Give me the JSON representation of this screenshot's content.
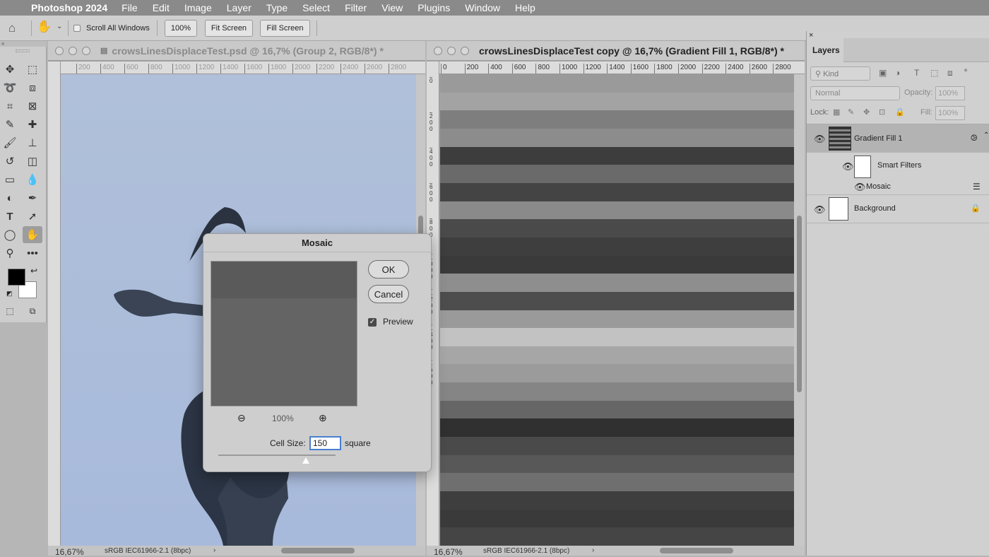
{
  "menubar": {
    "app_name": "Photoshop 2024",
    "items": [
      "File",
      "Edit",
      "Image",
      "Layer",
      "Type",
      "Select",
      "Filter",
      "View",
      "Plugins",
      "Window",
      "Help"
    ]
  },
  "options": {
    "scroll_all_label": "Scroll All Windows",
    "zoom_100": "100%",
    "fit_screen": "Fit Screen",
    "fill_screen": "Fill Screen"
  },
  "doc1": {
    "title": "crowsLinesDisplaceTest.psd @ 16,7% (Group 2, RGB/8*) *",
    "zoom": "16,67%",
    "profile": "sRGB IEC61966-2.1 (8bpc)",
    "hruler": [
      "200",
      "400",
      "600",
      "800",
      "1000",
      "1200",
      "1400",
      "1600",
      "1800",
      "2000",
      "2200",
      "2400",
      "2600",
      "2800"
    ]
  },
  "doc2": {
    "title": "crowsLinesDisplaceTest copy @ 16,7% (Gradient Fill 1, RGB/8*) *",
    "zoom": "16,67%",
    "profile": "sRGB IEC61966-2.1 (8bpc)",
    "hruler": [
      "0",
      "200",
      "400",
      "600",
      "800",
      "1000",
      "1200",
      "1400",
      "1600",
      "1800",
      "2000",
      "2200",
      "2400",
      "2600",
      "2800"
    ],
    "vruler": [
      "0",
      "2\n0\n0",
      "4\n0\n0",
      "6\n0\n0",
      "8\n0\n0",
      "1\n0\n0\n0",
      "1\n2\n0\n0",
      "1\n4\n0\n0",
      "1\n6\n0\n0"
    ]
  },
  "mosaic": {
    "title": "Mosaic",
    "ok": "OK",
    "cancel": "Cancel",
    "preview_label": "Preview",
    "preview_checked": true,
    "preview_zoom": "100%",
    "cell_size_label": "Cell Size:",
    "cell_size_value": "150",
    "unit": "square"
  },
  "layers_panel": {
    "tab": "Layers",
    "kind_placeholder": "Kind",
    "blend_mode": "Normal",
    "opacity_label": "Opacity:",
    "opacity_value": "100%",
    "lock_label": "Lock:",
    "fill_label": "Fill:",
    "fill_value": "100%",
    "layers": [
      {
        "name": "Gradient Fill 1"
      },
      {
        "name": "Smart Filters"
      },
      {
        "name": "Mosaic"
      },
      {
        "name": "Background"
      }
    ]
  },
  "colors": {
    "stripe_shades": [
      "#9a9a9a",
      "#a3a3a3",
      "#7e7e7e",
      "#8c8c8c",
      "#3d3d3d",
      "#6a6a6a",
      "#444",
      "#8a8a8a",
      "#4a4a4a",
      "#3e3e3e",
      "#3a3a3a",
      "#8e8e8e",
      "#4d4d4d",
      "#9a9a9a",
      "#c2c2c2",
      "#a6a6a6",
      "#9b9b9b",
      "#858585",
      "#666",
      "#303030",
      "#4a4a4a",
      "#585858",
      "#6f6f6f",
      "#3e3e3e",
      "#3a3a3a",
      "#454545"
    ],
    "sky": "#aebfd9",
    "crow": "#2f3a4a"
  }
}
